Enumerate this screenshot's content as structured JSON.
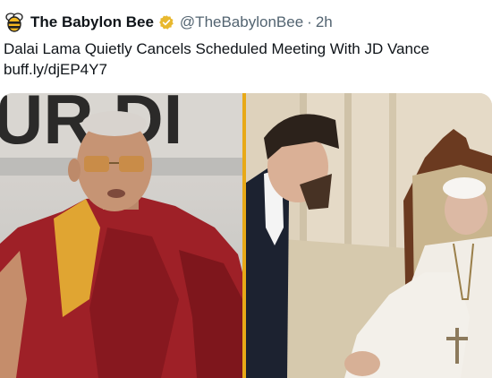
{
  "account": {
    "name": "The Babylon Bee",
    "handle": "@TheBabylonBee",
    "separator": "·",
    "time": "2h",
    "avatar_icon": "bee-icon",
    "verified_icon": "verified-badge-icon",
    "verified_color": "#e8b82e"
  },
  "tweet": {
    "text": "Dalai Lama Quietly Cancels Scheduled Meeting With JD Vance",
    "link": "buff.ly/djEP4Y7"
  },
  "media": {
    "left_photo_backdrop_text": "UR DI",
    "divider_color": "#e8a917"
  }
}
